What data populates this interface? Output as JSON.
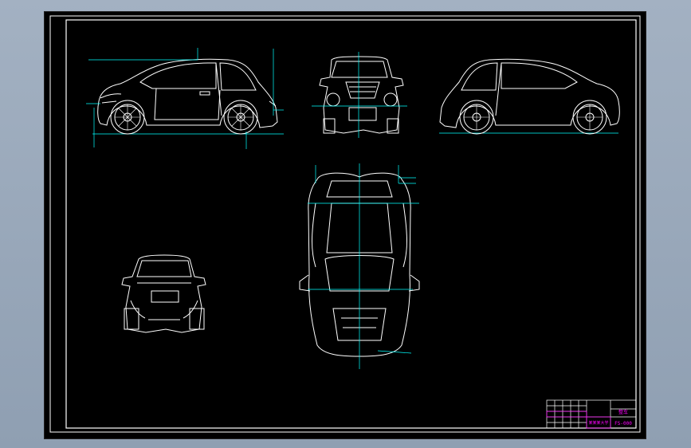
{
  "window": {
    "background": "#98a7ba",
    "sheet_color": "#000000"
  },
  "colors": {
    "geometry": "#ffffff",
    "centerline": "#00ffff",
    "frame": "#ffffff",
    "title_block_lines": "#ffffff",
    "title_block_accent": "#ff00ff"
  },
  "views": [
    {
      "name": "left-side-view",
      "icon": "car-side-icon"
    },
    {
      "name": "front-view",
      "icon": "car-front-icon"
    },
    {
      "name": "right-side-view",
      "icon": "car-side-icon"
    },
    {
      "name": "rear-view",
      "icon": "car-rear-icon"
    },
    {
      "name": "top-view",
      "icon": "car-top-icon"
    }
  ],
  "title_block": {
    "drawing_no": "FS-000",
    "title": "整车",
    "company": "某某某大学"
  }
}
